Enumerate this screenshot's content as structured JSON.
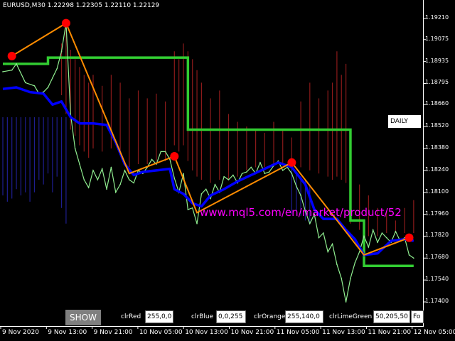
{
  "title": "EURUSD,M30  1.22298 1.22305 1.22110 1.22129",
  "daily_label": "DAILY",
  "watermark": "www.mql5.com/en/market/product/52",
  "show_button": "SHOW",
  "params": [
    {
      "label": "clrRed",
      "value": "255,0,0"
    },
    {
      "label": "clrBlue",
      "value": "0,0,255"
    },
    {
      "label": "clrOrange",
      "value": "255,140,0"
    },
    {
      "label": "clrLimeGreen",
      "value": "50,205,50"
    },
    {
      "label": "",
      "value": "Fo"
    }
  ],
  "colors": {
    "background": "#000000",
    "price_line": "#90ee90",
    "daily_level": "#32cd32",
    "blue_line": "#0000ff",
    "zigzag": "#ff8c00",
    "pivot_dot": "#ff0000",
    "histogram_red": "#8b1a1a",
    "histogram_blue": "#1e1e8f",
    "watermark": "#ff00ff"
  },
  "chart_data": {
    "type": "line",
    "symbol": "EURUSD",
    "timeframe": "M30",
    "ohlc": {
      "open": 1.22298,
      "high": 1.22305,
      "low": 1.2211,
      "close": 1.22129
    },
    "price_axis_ticks": [
      "1.19210",
      "1.19075",
      "1.18935",
      "1.18795",
      "1.18660",
      "1.18520",
      "1.18380",
      "1.18240",
      "1.18100",
      "1.17960",
      "1.17820",
      "1.17680",
      "1.17540",
      "1.17400"
    ],
    "time_axis_ticks": [
      "9 Nov 2020",
      "9 Nov 13:00",
      "9 Nov 21:00",
      "10 Nov 05:00",
      "10 Nov 13:00",
      "10 Nov 21:00",
      "11 Nov 05:00",
      "11 Nov 13:00",
      "11 Nov 21:00",
      "12 Nov 05:00"
    ],
    "ylim": [
      1.1733,
      1.1925
    ],
    "daily_level": [
      {
        "x": [
          0,
          10
        ],
        "y": 1.1892
      },
      {
        "x": [
          10,
          41
        ],
        "y": 1.1896
      },
      {
        "x": [
          41,
          77
        ],
        "y": 1.185
      },
      {
        "x": [
          77,
          80
        ],
        "y": 1.1792
      },
      {
        "x": [
          80,
          91
        ],
        "y": 1.1763
      }
    ],
    "zigzag": [
      {
        "x": 2,
        "y": 1.1897,
        "pivot": true
      },
      {
        "x": 14,
        "y": 1.1918,
        "pivot": true
      },
      {
        "x": 28,
        "y": 1.1822,
        "pivot": false
      },
      {
        "x": 38,
        "y": 1.1833,
        "pivot": true
      },
      {
        "x": 43,
        "y": 1.1797,
        "pivot": false
      },
      {
        "x": 64,
        "y": 1.1829,
        "pivot": true
      },
      {
        "x": 80,
        "y": 1.177,
        "pivot": false
      },
      {
        "x": 90,
        "y": 1.1781,
        "pivot": true
      }
    ],
    "blue_line": [
      [
        0,
        1.1876
      ],
      [
        3,
        1.1877
      ],
      [
        6,
        1.1874
      ],
      [
        9,
        1.1873
      ],
      [
        11,
        1.1866
      ],
      [
        13,
        1.1868
      ],
      [
        15,
        1.1858
      ],
      [
        17,
        1.1854
      ],
      [
        20,
        1.1854
      ],
      [
        23,
        1.1853
      ],
      [
        25,
        1.1842
      ],
      [
        27,
        1.1828
      ],
      [
        29,
        1.1821
      ],
      [
        31,
        1.1823
      ],
      [
        34,
        1.1824
      ],
      [
        37,
        1.1825
      ],
      [
        38,
        1.1812
      ],
      [
        40,
        1.1809
      ],
      [
        42,
        1.1803
      ],
      [
        44,
        1.1801
      ],
      [
        46,
        1.1808
      ],
      [
        49,
        1.1812
      ],
      [
        52,
        1.1817
      ],
      [
        55,
        1.1821
      ],
      [
        58,
        1.1825
      ],
      [
        61,
        1.1829
      ],
      [
        64,
        1.1826
      ],
      [
        67,
        1.1815
      ],
      [
        69,
        1.1799
      ],
      [
        71,
        1.1793
      ],
      [
        74,
        1.1793
      ],
      [
        76,
        1.1786
      ],
      [
        78,
        1.178
      ],
      [
        80,
        1.177
      ],
      [
        83,
        1.1771
      ],
      [
        86,
        1.1779
      ],
      [
        89,
        1.178
      ],
      [
        91,
        1.1779
      ]
    ],
    "price_line": [
      [
        0,
        1.1887
      ],
      [
        2,
        1.1888
      ],
      [
        3,
        1.1892
      ],
      [
        5,
        1.188
      ],
      [
        7,
        1.1878
      ],
      [
        8,
        1.1873
      ],
      [
        9,
        1.1874
      ],
      [
        10,
        1.1877
      ],
      [
        11,
        1.1883
      ],
      [
        12,
        1.1889
      ],
      [
        13,
        1.19
      ],
      [
        14,
        1.1918
      ],
      [
        15,
        1.186
      ],
      [
        16,
        1.1838
      ],
      [
        17,
        1.1828
      ],
      [
        18,
        1.1818
      ],
      [
        19,
        1.1813
      ],
      [
        20,
        1.1824
      ],
      [
        21,
        1.1818
      ],
      [
        22,
        1.1825
      ],
      [
        23,
        1.1812
      ],
      [
        24,
        1.1826
      ],
      [
        25,
        1.181
      ],
      [
        26,
        1.1815
      ],
      [
        27,
        1.1824
      ],
      [
        28,
        1.1818
      ],
      [
        29,
        1.1816
      ],
      [
        30,
        1.1824
      ],
      [
        31,
        1.1822
      ],
      [
        32,
        1.1826
      ],
      [
        33,
        1.1831
      ],
      [
        34,
        1.1828
      ],
      [
        35,
        1.1836
      ],
      [
        36,
        1.1836
      ],
      [
        37,
        1.1831
      ],
      [
        38,
        1.1819
      ],
      [
        39,
        1.181
      ],
      [
        40,
        1.1822
      ],
      [
        41,
        1.1799
      ],
      [
        42,
        1.18
      ],
      [
        43,
        1.179
      ],
      [
        44,
        1.1809
      ],
      [
        45,
        1.1812
      ],
      [
        46,
        1.1806
      ],
      [
        47,
        1.1815
      ],
      [
        48,
        1.181
      ],
      [
        49,
        1.182
      ],
      [
        50,
        1.1818
      ],
      [
        51,
        1.1821
      ],
      [
        52,
        1.1816
      ],
      [
        53,
        1.1822
      ],
      [
        54,
        1.1823
      ],
      [
        55,
        1.1826
      ],
      [
        56,
        1.1822
      ],
      [
        57,
        1.1829
      ],
      [
        58,
        1.1822
      ],
      [
        59,
        1.1823
      ],
      [
        60,
        1.1827
      ],
      [
        61,
        1.183
      ],
      [
        62,
        1.1824
      ],
      [
        63,
        1.1826
      ],
      [
        64,
        1.1822
      ],
      [
        65,
        1.1814
      ],
      [
        66,
        1.1808
      ],
      [
        67,
        1.1798
      ],
      [
        68,
        1.179
      ],
      [
        69,
        1.1796
      ],
      [
        70,
        1.1781
      ],
      [
        71,
        1.1784
      ],
      [
        72,
        1.1772
      ],
      [
        73,
        1.1777
      ],
      [
        74,
        1.1764
      ],
      [
        75,
        1.1755
      ],
      [
        76,
        1.174
      ],
      [
        77,
        1.1755
      ],
      [
        78,
        1.1765
      ],
      [
        79,
        1.1772
      ],
      [
        80,
        1.1782
      ],
      [
        81,
        1.1775
      ],
      [
        82,
        1.1786
      ],
      [
        83,
        1.1778
      ],
      [
        84,
        1.1784
      ],
      [
        85,
        1.1781
      ],
      [
        86,
        1.1778
      ],
      [
        87,
        1.1785
      ],
      [
        88,
        1.1779
      ],
      [
        89,
        1.1781
      ],
      [
        90,
        1.177
      ],
      [
        91,
        1.1768
      ]
    ],
    "red_histogram": [
      [
        13,
        1.1905,
        1.1872
      ],
      [
        14,
        1.1918,
        1.186
      ],
      [
        15,
        1.1901,
        1.185
      ],
      [
        16,
        1.1895,
        1.1846
      ],
      [
        17,
        1.189,
        1.184
      ],
      [
        18,
        1.1885,
        1.1836
      ],
      [
        19,
        1.188,
        1.1832
      ],
      [
        20,
        1.1885,
        1.1838
      ],
      [
        22,
        1.1878,
        1.1836
      ],
      [
        24,
        1.1885,
        1.1838
      ],
      [
        26,
        1.188,
        1.1834
      ],
      [
        28,
        1.187,
        1.1826
      ],
      [
        30,
        1.1875,
        1.1828
      ],
      [
        32,
        1.187,
        1.1828
      ],
      [
        34,
        1.1873,
        1.183
      ],
      [
        36,
        1.1868,
        1.183
      ],
      [
        38,
        1.19,
        1.184
      ],
      [
        39,
        1.1895,
        1.1836
      ],
      [
        40,
        1.1905,
        1.184
      ],
      [
        41,
        1.19,
        1.183
      ],
      [
        42,
        1.1895,
        1.1824
      ],
      [
        43,
        1.1888,
        1.182
      ],
      [
        44,
        1.188,
        1.1818
      ],
      [
        46,
        1.187,
        1.1816
      ],
      [
        48,
        1.1875,
        1.1818
      ],
      [
        50,
        1.186,
        1.1818
      ],
      [
        52,
        1.1855,
        1.182
      ],
      [
        54,
        1.1852,
        1.1824
      ],
      [
        56,
        1.185,
        1.1826
      ],
      [
        58,
        1.1848,
        1.1826
      ],
      [
        60,
        1.1855,
        1.1828
      ],
      [
        62,
        1.185,
        1.1828
      ],
      [
        64,
        1.1845,
        1.1826
      ],
      [
        66,
        1.1868,
        1.1826
      ],
      [
        68,
        1.188,
        1.1824
      ],
      [
        70,
        1.187,
        1.1822
      ],
      [
        72,
        1.1875,
        1.182
      ],
      [
        73,
        1.188,
        1.1818
      ],
      [
        74,
        1.19,
        1.182
      ],
      [
        75,
        1.1885,
        1.1818
      ],
      [
        76,
        1.1892,
        1.1816
      ],
      [
        77,
        1.1825,
        1.179
      ],
      [
        79,
        1.1815,
        1.1786
      ],
      [
        81,
        1.1808,
        1.1782
      ],
      [
        83,
        1.18,
        1.1782
      ],
      [
        85,
        1.1798,
        1.1784
      ],
      [
        87,
        1.1792,
        1.1784
      ],
      [
        89,
        1.18,
        1.1784
      ],
      [
        91,
        1.1805,
        1.1784
      ]
    ],
    "blue_histogram": [
      [
        0,
        1.1858,
        1.1808
      ],
      [
        1,
        1.1858,
        1.1804
      ],
      [
        2,
        1.1858,
        1.1806
      ],
      [
        3,
        1.1858,
        1.1812
      ],
      [
        4,
        1.1858,
        1.1808
      ],
      [
        5,
        1.1858,
        1.181
      ],
      [
        6,
        1.1858,
        1.1804
      ],
      [
        7,
        1.1858,
        1.181
      ],
      [
        8,
        1.1858,
        1.1818
      ],
      [
        9,
        1.1858,
        1.1815
      ],
      [
        10,
        1.1858,
        1.1822
      ],
      [
        11,
        1.1858,
        1.181
      ],
      [
        12,
        1.1858,
        1.182
      ],
      [
        13,
        1.1858,
        1.18
      ],
      [
        14,
        1.1858,
        1.179
      ],
      [
        64,
        1.1826,
        1.1796
      ],
      [
        65,
        1.1822,
        1.1798
      ],
      [
        66,
        1.182,
        1.1795
      ],
      [
        67,
        1.1818,
        1.1792
      ],
      [
        68,
        1.1815,
        1.179
      ]
    ]
  }
}
